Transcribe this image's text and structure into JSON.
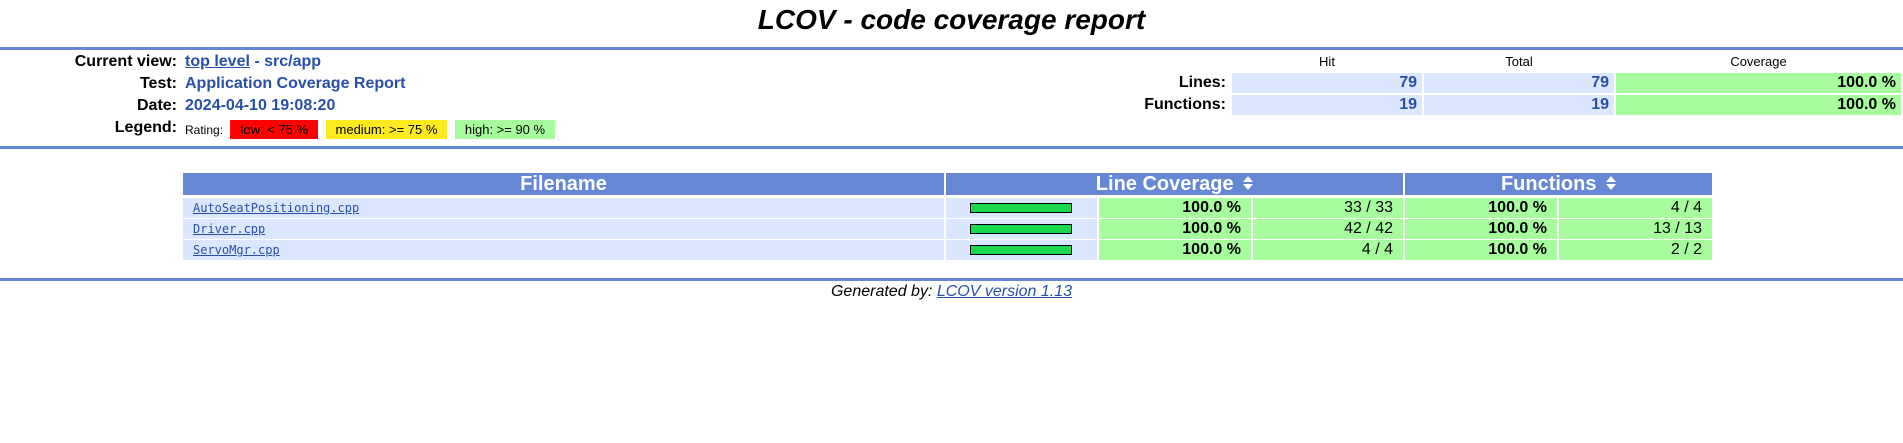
{
  "title": "LCOV - code coverage report",
  "header": {
    "current_view_label": "Current view:",
    "current_view_link": "top level",
    "current_view_rest": " - src/app",
    "test_label": "Test:",
    "test_value": "Application Coverage Report",
    "date_label": "Date:",
    "date_value": "2024-04-10 19:08:20",
    "legend_label": "Legend:",
    "legend_rating": "Rating:",
    "legend_low": "low: < 75 %",
    "legend_medium": "medium: >= 75 %",
    "legend_high": "high: >= 90 %"
  },
  "summary": {
    "col_hit": "Hit",
    "col_total": "Total",
    "col_coverage": "Coverage",
    "lines": {
      "label": "Lines:",
      "hit": "79",
      "total": "79",
      "coverage": "100.0 %"
    },
    "functions": {
      "label": "Functions:",
      "hit": "19",
      "total": "19",
      "coverage": "100.0 %"
    }
  },
  "file_table": {
    "col_filename": "Filename",
    "col_line_coverage": "Line Coverage",
    "col_functions": "Functions",
    "rows": [
      {
        "name": "AutoSeatPositioning.cpp",
        "line_pct": "100.0 %",
        "line_count": "33 / 33",
        "func_pct": "100.0 %",
        "func_count": "4 / 4",
        "bar_fraction": 1.0
      },
      {
        "name": "Driver.cpp",
        "line_pct": "100.0 %",
        "line_count": "42 / 42",
        "func_pct": "100.0 %",
        "func_count": "13 / 13",
        "bar_fraction": 1.0
      },
      {
        "name": "ServoMgr.cpp",
        "line_pct": "100.0 %",
        "line_count": "4 / 4",
        "func_pct": "100.0 %",
        "func_count": "2 / 2",
        "bar_fraction": 1.0
      }
    ]
  },
  "footer": {
    "prefix": "Generated by: ",
    "link": "LCOV version 1.13"
  },
  "colors": {
    "ruler": "#6688d4",
    "header_bg": "#6688d4",
    "number_bg": "#dae7fe",
    "high_bg": "#a7fc9d",
    "medium_bg": "#ffea20",
    "low_bg": "#ff0000",
    "bar_fill": "#1bd94c",
    "link": "#284fa8"
  }
}
